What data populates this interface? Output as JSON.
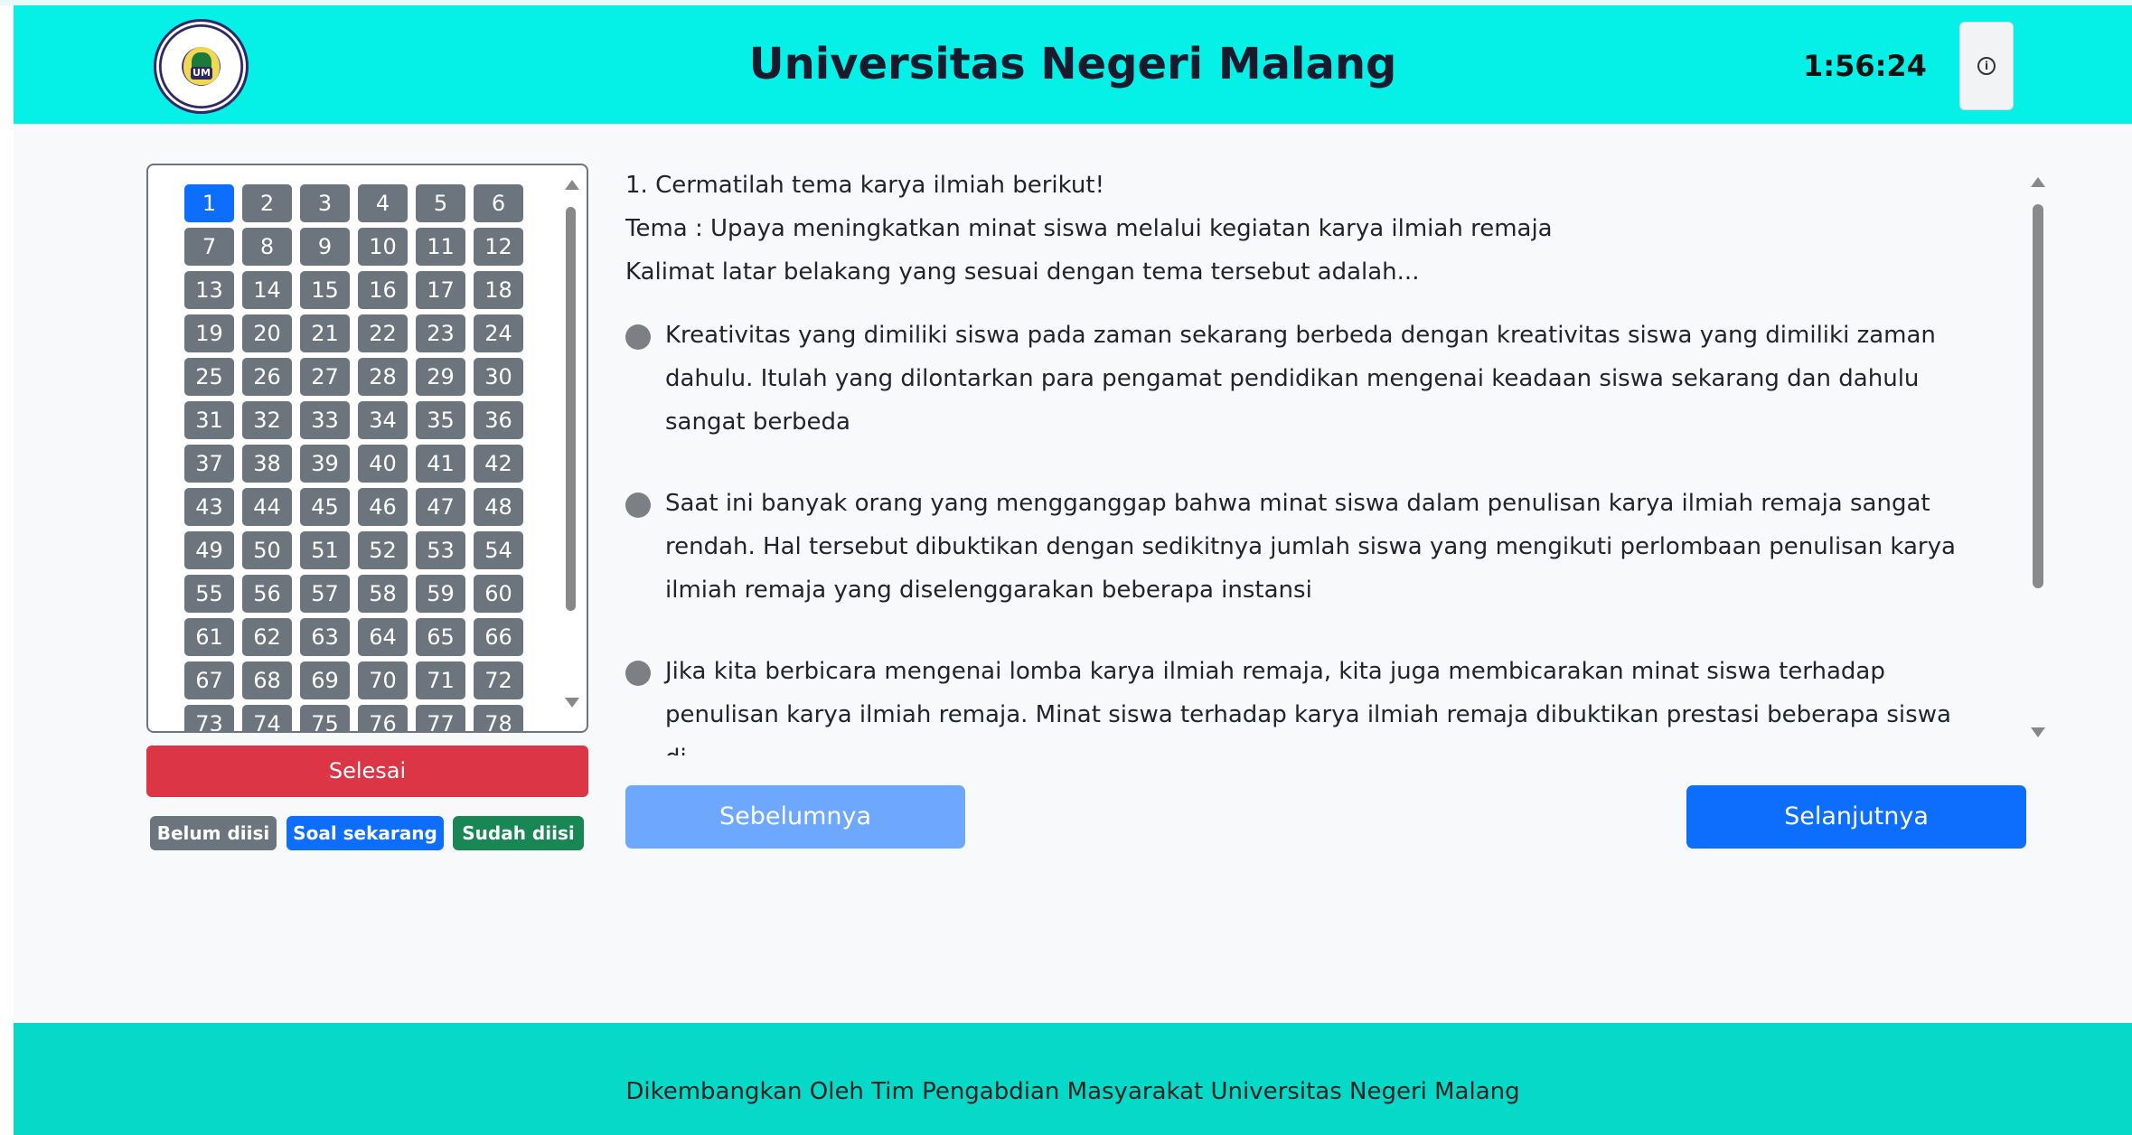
{
  "header": {
    "title": "Universitas Negeri Malang",
    "timer": "1:56:24",
    "info_icon": "info-circle-icon",
    "logo_text": "UNIVERSITAS NEGERI MALANG"
  },
  "navigator": {
    "current": 1,
    "numbers": [
      "1",
      "2",
      "3",
      "4",
      "5",
      "6",
      "7",
      "8",
      "9",
      "10",
      "11",
      "12",
      "13",
      "14",
      "15",
      "16",
      "17",
      "18",
      "19",
      "20",
      "21",
      "22",
      "23",
      "24",
      "25",
      "26",
      "27",
      "28",
      "29",
      "30",
      "31",
      "32",
      "33",
      "34",
      "35",
      "36",
      "37",
      "38",
      "39",
      "40",
      "41",
      "42",
      "43",
      "44",
      "45",
      "46",
      "47",
      "48",
      "49",
      "50",
      "51",
      "52",
      "53",
      "54",
      "55",
      "56",
      "57",
      "58",
      "59",
      "60",
      "61",
      "62",
      "63",
      "64",
      "65",
      "66",
      "67",
      "68",
      "69",
      "70",
      "71",
      "72",
      "73",
      "74",
      "75",
      "76",
      "77",
      "78"
    ],
    "finish_label": "Selesai",
    "legend": {
      "unanswered": "Belum diisi",
      "current": "Soal sekarang",
      "answered": "Sudah diisi"
    }
  },
  "question": {
    "lines": [
      "1. Cermatilah tema karya ilmiah berikut!",
      "Tema : Upaya meningkatkan minat siswa melalui kegiatan karya ilmiah remaja",
      "Kalimat latar belakang yang sesuai dengan tema tersebut adalah..."
    ],
    "options": [
      "Kreativitas yang dimiliki siswa pada zaman sekarang berbeda dengan kreativitas siswa yang dimiliki zaman dahulu. Itulah yang dilontarkan para pengamat pendidikan mengenai keadaan siswa sekarang dan dahulu sangat berbeda",
      "Saat ini banyak orang yang mengganggap bahwa minat siswa dalam penulisan karya ilmiah remaja sangat rendah. Hal tersebut dibuktikan dengan sedikitnya jumlah siswa yang mengikuti perlombaan penulisan karya ilmiah remaja yang diselenggarakan beberapa instansi",
      "Jika kita berbicara mengenai lomba karya ilmiah remaja, kita juga membicarakan minat siswa terhadap penulisan karya ilmiah remaja. Minat siswa terhadap karya ilmiah remaja dibuktikan prestasi beberapa siswa di"
    ]
  },
  "buttons": {
    "prev": "Sebelumnya",
    "next": "Selanjutnya"
  },
  "footer": {
    "text": "Dikembangkan Oleh Tim Pengabdian Masyarakat Universitas Negeri Malang"
  },
  "colors": {
    "header_bg": "#05f0e6",
    "footer_bg": "#07d9c8",
    "primary": "#0d6efd",
    "danger": "#dc3545",
    "success": "#198754",
    "secondary": "#6c757d"
  }
}
